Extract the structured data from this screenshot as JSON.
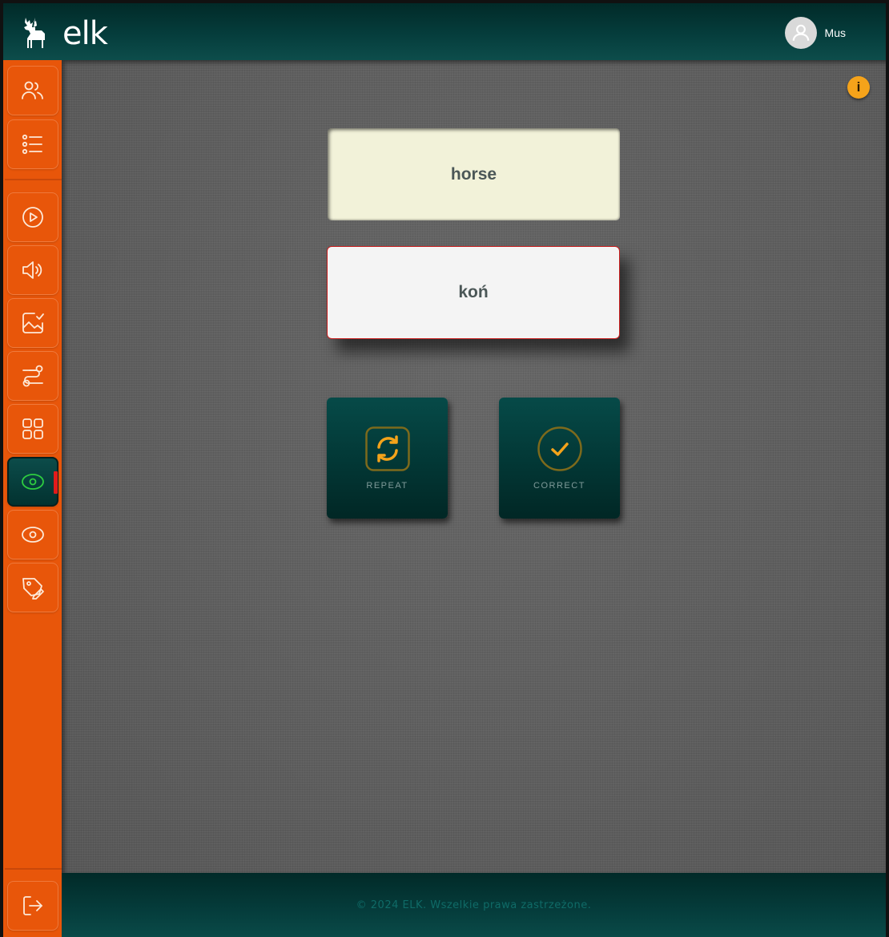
{
  "header": {
    "logo_text": "elk",
    "user_name": "Mus"
  },
  "sidebar": {
    "items": [
      {
        "icon": "users-icon",
        "label": "Users"
      },
      {
        "icon": "list-icon",
        "label": "List"
      },
      {
        "icon": "play-icon",
        "label": "Play"
      },
      {
        "icon": "speaker-icon",
        "label": "Listen"
      },
      {
        "icon": "image-check-icon",
        "label": "Picture check"
      },
      {
        "icon": "route-icon",
        "label": "Route"
      },
      {
        "icon": "grid-icon",
        "label": "Grid"
      },
      {
        "icon": "eye-icon",
        "label": "Eye (active)"
      },
      {
        "icon": "eye-icon",
        "label": "Eye"
      },
      {
        "icon": "tag-pencil-icon",
        "label": "Tag edit"
      }
    ],
    "active_index": 7,
    "logout_icon": "logout-icon"
  },
  "main": {
    "info_label": "i",
    "word": "horse",
    "answer": "koń",
    "repeat_label": "REPEAT",
    "correct_label": "CORRECT"
  },
  "footer": {
    "copyright": "© 2024 ELK. Wszelkie prawa zastrzeżone."
  },
  "colors": {
    "sidebar": "#e8560a",
    "header": "#053d3c",
    "accent": "#f5a31a",
    "card_word_bg": "#f2f2d9",
    "answer_border": "#c71c1c",
    "active_eye": "#2ecc40"
  }
}
